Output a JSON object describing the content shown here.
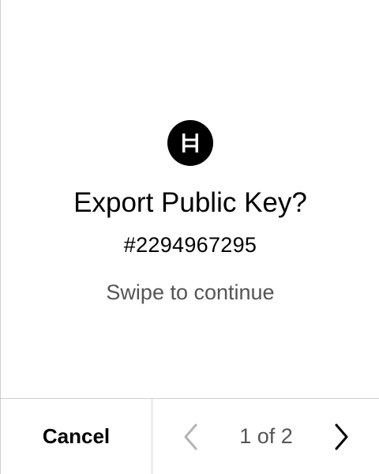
{
  "app": {
    "logo_icon": "hedera-logo-icon",
    "title": "Export Public Key?",
    "account_id": "#2294967295",
    "hint": "Swipe to continue"
  },
  "footer": {
    "cancel_label": "Cancel",
    "prev_icon": "chevron-left-icon",
    "next_icon": "chevron-right-icon",
    "page_indicator": "1 of 2",
    "prev_enabled": false
  },
  "colors": {
    "text": "#000000",
    "muted_text": "#555555",
    "disabled_icon": "#b5b5b5",
    "divider": "#cfcfcf",
    "background": "#ffffff"
  }
}
